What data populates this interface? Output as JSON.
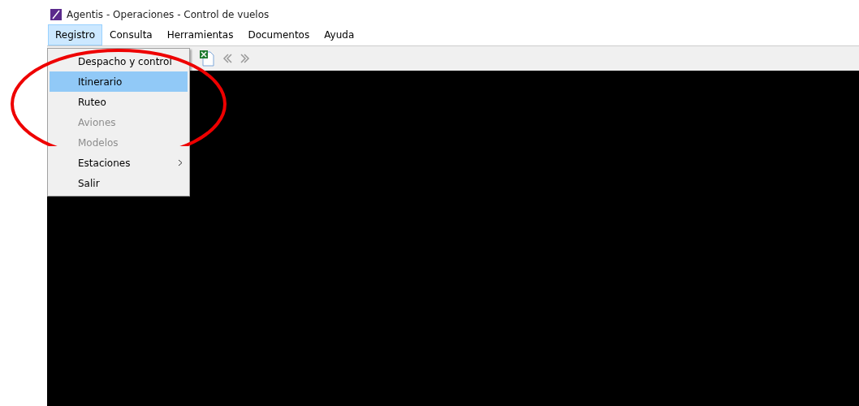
{
  "window": {
    "title": "Agentis - Operaciones - Control de vuelos"
  },
  "menu_bar": [
    {
      "label": "Registro",
      "selected": true
    },
    {
      "label": "Consulta",
      "selected": false
    },
    {
      "label": "Herramientas",
      "selected": false
    },
    {
      "label": "Documentos",
      "selected": false
    },
    {
      "label": "Ayuda",
      "selected": false
    }
  ],
  "dropdown": [
    {
      "label": "Despacho y control",
      "selected": false,
      "disabled": false,
      "submenu": false
    },
    {
      "label": "Itinerario",
      "selected": true,
      "disabled": false,
      "submenu": false
    },
    {
      "label": "Ruteo",
      "selected": false,
      "disabled": false,
      "submenu": false
    },
    {
      "label": "Aviones",
      "selected": false,
      "disabled": true,
      "submenu": false
    },
    {
      "label": "Modelos",
      "selected": false,
      "disabled": true,
      "submenu": false
    },
    {
      "label": "Estaciones",
      "selected": false,
      "disabled": false,
      "submenu": true
    },
    {
      "label": "Salir",
      "selected": false,
      "disabled": false,
      "submenu": false
    }
  ]
}
